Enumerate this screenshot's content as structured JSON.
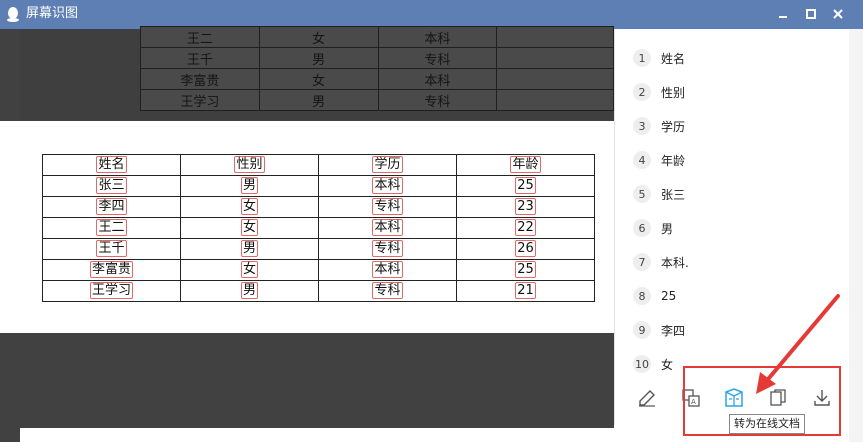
{
  "window": {
    "title": "屏幕识图"
  },
  "top_table": [
    [
      "王二",
      "女",
      "本科"
    ],
    [
      "王千",
      "男",
      "专科"
    ],
    [
      "李富贵",
      "女",
      "本科"
    ],
    [
      "王学习",
      "男",
      "专科"
    ]
  ],
  "main_table": {
    "headers": [
      "姓名",
      "性别",
      "学历",
      "年龄"
    ],
    "rows": [
      [
        "张三",
        "男",
        "本科",
        "25"
      ],
      [
        "李四",
        "女",
        "专科",
        "23"
      ],
      [
        "王二",
        "女",
        "本科",
        "22"
      ],
      [
        "王千",
        "男",
        "专科",
        "26"
      ],
      [
        "李富贵",
        "女",
        "本科",
        "25"
      ],
      [
        "王学习",
        "男",
        "专科",
        "21"
      ]
    ]
  },
  "results": [
    {
      "n": "1",
      "text": "姓名"
    },
    {
      "n": "2",
      "text": "性别"
    },
    {
      "n": "3",
      "text": "学历"
    },
    {
      "n": "4",
      "text": "年龄"
    },
    {
      "n": "5",
      "text": "张三"
    },
    {
      "n": "6",
      "text": "男"
    },
    {
      "n": "7",
      "text": "本科."
    },
    {
      "n": "8",
      "text": "25"
    },
    {
      "n": "9",
      "text": "李四"
    },
    {
      "n": "10",
      "text": "女"
    }
  ],
  "toolbar": {
    "tooltip": "转为在线文档",
    "icons": [
      "edit-icon",
      "translate-icon",
      "online-doc-icon",
      "copy-icon",
      "download-icon"
    ]
  },
  "colors": {
    "titlebar": "#5d7fb3",
    "accent": "#2aa4e8",
    "annotation": "#e53935"
  }
}
